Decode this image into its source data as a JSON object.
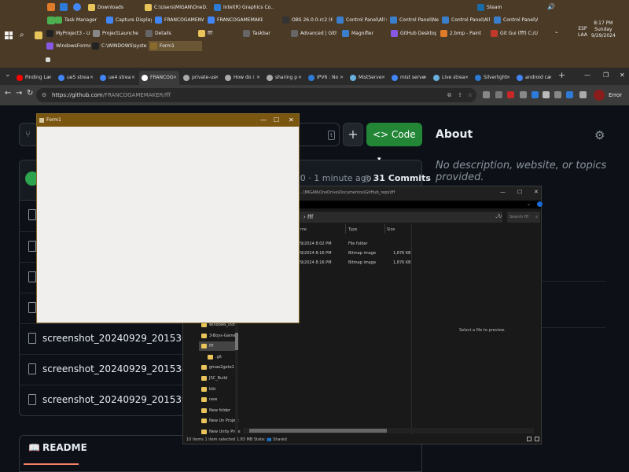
{
  "taskbar": {
    "search_label": "⌕",
    "row1": [
      {
        "label": "Downloads",
        "color": "#e8c45a"
      },
      {
        "label": "C:\\Users\\MIGAN\\OneD...",
        "color": "#e8c45a"
      },
      {
        "label": "Intel(R) Graphics Co...",
        "color": "#2d7bd6"
      },
      {
        "label": "Steam",
        "color": "#1b6aa8"
      }
    ],
    "row2": [
      {
        "label": "Task Manager",
        "color": "#4caf50"
      },
      {
        "label": "Capture Display BMP ...",
        "color": "#4285f4"
      },
      {
        "label": "FRANCOGAMEMAKE...",
        "color": "#4285f4"
      },
      {
        "label": "FRANCOGAMEMAKE...",
        "color": "#4285f4"
      },
      {
        "label": "OBS 26.0.0-rc2 (64-...",
        "color": "#333"
      },
      {
        "label": "Control Panel\\All Cont...",
        "color": "#3b7fcc"
      },
      {
        "label": "Control Panel\\Networ...",
        "color": "#3b7fcc"
      },
      {
        "label": "Control Panel\\All Cont...",
        "color": "#3b7fcc"
      },
      {
        "label": "Control Panel\\All Cont...",
        "color": "#3b7fcc"
      }
    ],
    "row3": [
      {
        "label": "MyProject3 - Unreal ...",
        "color": "#222"
      },
      {
        "label": "ProjectLauncher",
        "color": "#888"
      },
      {
        "label": "Details",
        "color": "#666"
      },
      {
        "label": "fff",
        "color": "#e8c45a"
      },
      {
        "label": "Taskbar",
        "color": "#666"
      },
      {
        "label": "Advanced | Github...",
        "color": "#666"
      },
      {
        "label": "Magnifier",
        "color": "#3b7fcc"
      },
      {
        "label": "GitHub Desktop",
        "color": "#8957e5"
      },
      {
        "label": "2.bmp - Paint",
        "color": "#e07b2a"
      },
      {
        "label": "Git Gui (fff) C:/Use...",
        "color": "#c0392b"
      }
    ],
    "row4": [
      {
        "label": "WindowsFormsApp3 -...",
        "color": "#8957e5"
      },
      {
        "label": "C:\\WINDOWS\\system...",
        "color": "#222"
      },
      {
        "label": "Form1",
        "color": "#8a6a2a"
      }
    ],
    "tray_lang": "ESP\nLAA",
    "tray_time": "8:17 PM\nSunday\n9/29/2024"
  },
  "browser": {
    "tabs": [
      {
        "label": "Finding La",
        "color": "#ff0000"
      },
      {
        "label": "ue5 strea",
        "color": "#4285f4"
      },
      {
        "label": "ue4 strea",
        "color": "#4285f4"
      },
      {
        "label": "FRANCOG",
        "color": "#ffffff"
      },
      {
        "label": "private-us",
        "color": "#aaa"
      },
      {
        "label": "How do i",
        "color": "#aaa"
      },
      {
        "label": "sharing p",
        "color": "#aaa"
      },
      {
        "label": "IPV6 : No",
        "color": "#2d7bd6"
      },
      {
        "label": "MistServe",
        "color": "#6ab0de"
      },
      {
        "label": "mist serve",
        "color": "#4285f4"
      },
      {
        "label": "Live strea",
        "color": "#6ab0de"
      },
      {
        "label": "Silverlight",
        "color": "#2d7bd6"
      },
      {
        "label": "android ca",
        "color": "#4285f4"
      }
    ],
    "url_host": "https://github.com",
    "url_path": "/FRANCOGAMEMAKER/fff",
    "profile_error": "Error"
  },
  "github": {
    "code_label": "<> Code",
    "goto_plus": "+",
    "about_title": "About",
    "about_desc": "No description, website, or topics provided.",
    "commit_time": "e30 · 1 minute ago",
    "commit_count": "31 Commits",
    "files": [
      {
        "name": ""
      },
      {
        "name": ""
      },
      {
        "name": ""
      },
      {
        "name": ""
      },
      {
        "name": "screenshot_20240929_201530.b..."
      },
      {
        "name": "screenshot_20240929_201534.b..."
      },
      {
        "name": "screenshot_20240929_201539.b..."
      }
    ],
    "readme_label": "README"
  },
  "form1": {
    "title": "Form1"
  },
  "explorer": {
    "path": "...\\MIGAN\\OneDrive\\Documentos\\GitHub_repo\\fff",
    "address": "› fff",
    "search_placeholder": "Search fff",
    "col_name": "me",
    "col_type": "Type",
    "col_size": "Size",
    "rows": [
      {
        "date": "29/2024 8:02 PM",
        "type": "File folder",
        "size": ""
      },
      {
        "date": "29/2024 8:16 PM",
        "type": "Bitmap image",
        "size": "1,876 KB"
      },
      {
        "date": "29/2024 8:16 PM",
        "type": "Bitmap image",
        "size": "1,876 KB"
      }
    ],
    "preview_msg": "Select a file to preview.",
    "tree": [
      {
        "label": "windows_icon"
      },
      {
        "label": "3-Boys-Game"
      },
      {
        "label": "fff",
        "selected": true
      },
      {
        "label": ".git"
      },
      {
        "label": "gmae2gate1"
      },
      {
        "label": "JSC_Build"
      },
      {
        "label": "kiki"
      },
      {
        "label": "new"
      },
      {
        "label": "New folder"
      },
      {
        "label": "New Un Project"
      },
      {
        "label": "New Unity Proje"
      }
    ],
    "status": "10 items   1 item selected 1.83 MB   State: 👥 Shared"
  }
}
